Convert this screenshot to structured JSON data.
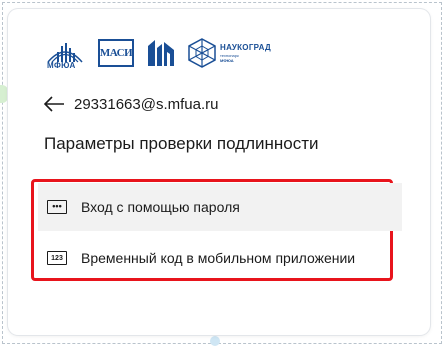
{
  "logos": {
    "mfua": {
      "name": "МФЮА"
    },
    "masi": {
      "name": "МАСИ"
    },
    "naukograd": {
      "title": "НАУКОГРАД",
      "subtitle": "технопарк",
      "subtitle2": "МФЮА"
    }
  },
  "account": {
    "email": "29331663@s.mfua.ru"
  },
  "page": {
    "title": "Параметры проверки подлинности"
  },
  "options": [
    {
      "label": "Вход с помощью пароля",
      "icon": "password-dots-icon",
      "icon_text": "•••"
    },
    {
      "label": "Временный код в мобильном приложении",
      "icon": "code-123-icon",
      "icon_text": "123"
    }
  ],
  "colors": {
    "highlight_border": "#e8141c",
    "brand": "#1a4f96",
    "hover_bg": "#f2f2f2"
  }
}
